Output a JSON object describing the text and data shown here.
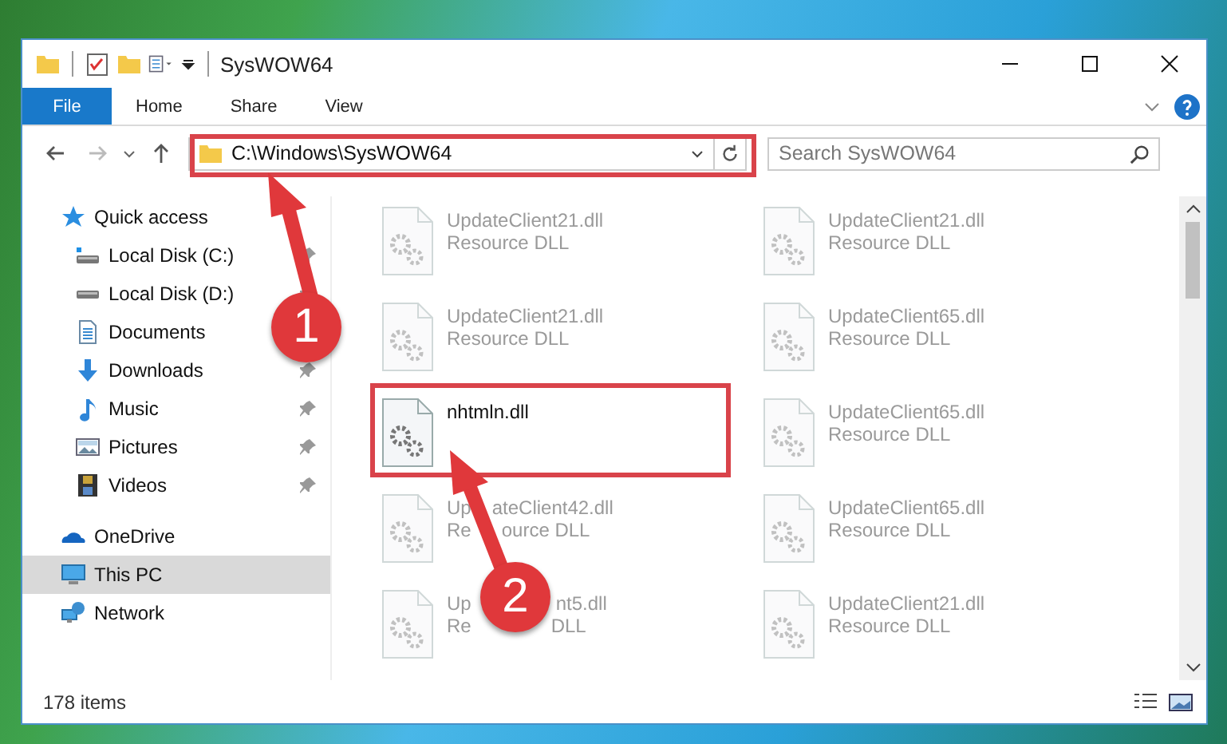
{
  "window": {
    "title": "SysWOW64"
  },
  "ribbon_tabs": [
    {
      "label": "File",
      "kind": "file"
    },
    {
      "label": "Home",
      "kind": "tab"
    },
    {
      "label": "Share",
      "kind": "tab"
    },
    {
      "label": "View",
      "kind": "tab"
    }
  ],
  "address_bar": {
    "path": "C:\\Windows\\SysWOW64"
  },
  "search": {
    "placeholder": "Search SysWOW64"
  },
  "sidebar": {
    "items": [
      {
        "label": "Quick access",
        "kind": "star",
        "selected": false,
        "children": [
          {
            "label": "Local Disk (C:)",
            "kind": "drive-c",
            "pinned": true,
            "selected": false
          },
          {
            "label": "Local Disk (D:)",
            "kind": "drive",
            "pinned": true,
            "selected": false
          },
          {
            "label": "Documents",
            "kind": "document",
            "pinned": false,
            "selected": false
          },
          {
            "label": "Downloads",
            "kind": "download",
            "pinned": true,
            "selected": false
          },
          {
            "label": "Music",
            "kind": "music",
            "pinned": true,
            "selected": false
          },
          {
            "label": "Pictures",
            "kind": "picture",
            "pinned": true,
            "selected": false
          },
          {
            "label": "Videos",
            "kind": "video",
            "pinned": true,
            "selected": false
          }
        ]
      },
      {
        "label": "OneDrive",
        "kind": "cloud",
        "selected": false
      },
      {
        "label": "This PC",
        "kind": "pc",
        "selected": true
      },
      {
        "label": "Network",
        "kind": "network",
        "selected": false
      }
    ]
  },
  "files": [
    {
      "name": "UpdateClient21.dll",
      "type": "Resource DLL",
      "faded": true
    },
    {
      "name": "UpdateClient21.dll",
      "type": "Resource DLL",
      "faded": true
    },
    {
      "name": "UpdateClient21.dll",
      "type": "Resource DLL",
      "faded": true
    },
    {
      "name": "UpdateClient65.dll",
      "type": "Resource DLL",
      "faded": true
    },
    {
      "name": "nhtmln.dll",
      "faded": false
    },
    {
      "name": "UpdateClient65.dll",
      "type": "Resource DLL",
      "faded": true
    },
    {
      "name_parts": [
        "Up",
        "ateClient42.dll"
      ],
      "type_parts": [
        "Re",
        "ource DLL"
      ],
      "faded": true
    },
    {
      "name": "UpdateClient65.dll",
      "type": "Resource DLL",
      "faded": true
    },
    {
      "name_parts": [
        "Up",
        "nt5.dll"
      ],
      "type_parts": [
        "Re",
        "DLL"
      ],
      "faded": true
    },
    {
      "name": "UpdateClient21.dll",
      "type": "Resource DLL",
      "faded": true
    }
  ],
  "status_bar": {
    "item_count": "178 items"
  },
  "annotations": [
    {
      "number": "1"
    },
    {
      "number": "2"
    }
  ]
}
